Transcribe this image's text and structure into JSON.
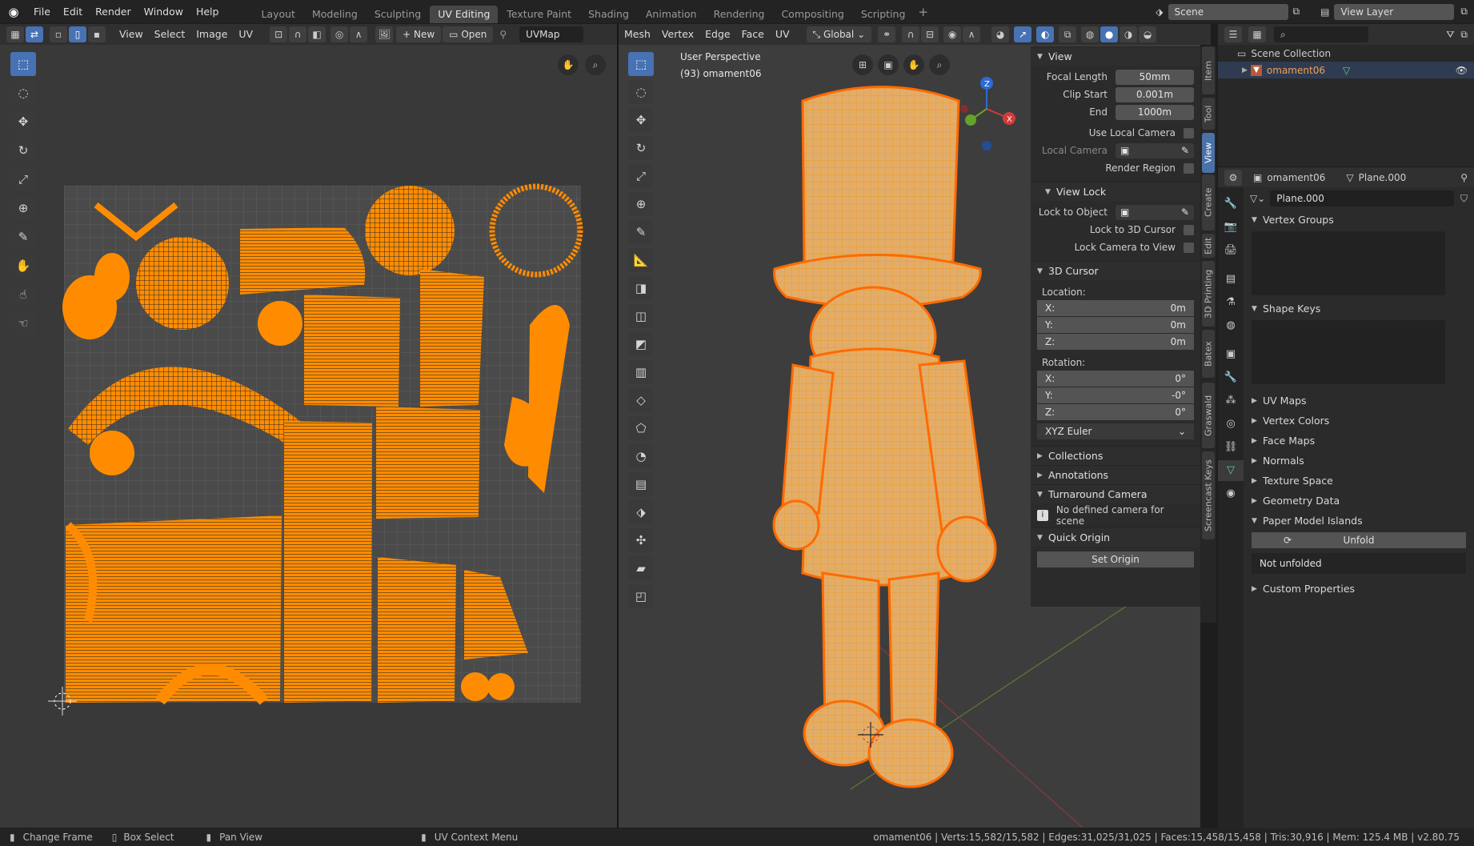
{
  "menus": [
    "File",
    "Edit",
    "Render",
    "Window",
    "Help"
  ],
  "workspaces": [
    "Layout",
    "Modeling",
    "Sculpting",
    "UV Editing",
    "Texture Paint",
    "Shading",
    "Animation",
    "Rendering",
    "Compositing",
    "Scripting"
  ],
  "scene": "Scene",
  "view_layer": "View Layer",
  "uv_header": {
    "menus": [
      "View",
      "Select",
      "Image",
      "UV"
    ],
    "new": "New",
    "open": "Open",
    "uvmap": "UVMap"
  },
  "vp_header": {
    "menus": [
      "Mesh",
      "Vertex",
      "Edge",
      "Face",
      "UV"
    ],
    "orientation": "Global"
  },
  "viewport": {
    "title": "User Perspective",
    "subtitle": "(93) omament06"
  },
  "npanel": {
    "view_title": "View",
    "focal_label": "Focal Length",
    "focal": "50mm",
    "clip_start_label": "Clip Start",
    "clip_start": "0.001m",
    "end_label": "End",
    "end": "1000m",
    "use_local_camera": "Use Local Camera",
    "local_camera": "Local Camera",
    "render_region": "Render Region",
    "view_lock": "View Lock",
    "lock_object": "Lock to Object",
    "lock_cursor": "Lock to 3D Cursor",
    "lock_camera": "Lock Camera to View",
    "cursor_title": "3D Cursor",
    "location": "Location:",
    "rotation": "Rotation:",
    "loc": [
      [
        "X:",
        "0m"
      ],
      [
        "Y:",
        "0m"
      ],
      [
        "Z:",
        "0m"
      ]
    ],
    "rot": [
      [
        "X:",
        "0°"
      ],
      [
        "Y:",
        "-0°"
      ],
      [
        "Z:",
        "0°"
      ]
    ],
    "euler": "XYZ Euler",
    "collections": "Collections",
    "annotations": "Annotations",
    "turnaround": "Turnaround Camera",
    "no_camera": "No defined camera for scene",
    "quick_origin": "Quick Origin",
    "set_origin": "Set Origin"
  },
  "side_tabs": [
    "Item",
    "Tool",
    "View",
    "Create",
    "Edit",
    "3D Printing",
    "Batex",
    "Graswald",
    "Screencast Keys"
  ],
  "outliner": {
    "collection": "Scene Collection",
    "object": "omament06"
  },
  "props": {
    "object": "omament06",
    "mesh": "Plane.000",
    "mesh_field": "Plane.000",
    "vertex_groups": "Vertex Groups",
    "shape_keys": "Shape Keys",
    "sections": [
      "UV Maps",
      "Vertex Colors",
      "Face Maps",
      "Normals",
      "Texture Space",
      "Geometry Data"
    ],
    "paper": "Paper Model Islands",
    "unfold": "Unfold",
    "not_unfolded": "Not unfolded",
    "custom": "Custom Properties"
  },
  "status": {
    "change_frame": "Change Frame",
    "box_select": "Box Select",
    "pan_view": "Pan View",
    "uv_context": "UV Context Menu",
    "stats": "omament06 | Verts:15,582/15,582 | Edges:31,025/31,025 | Faces:15,458/15,458 | Tris:30,916 | Mem: 125.4 MB | v2.80.75"
  },
  "colors": {
    "accent": "#4772b3",
    "selected": "#ff8c00",
    "outline": "#ff6a00"
  }
}
